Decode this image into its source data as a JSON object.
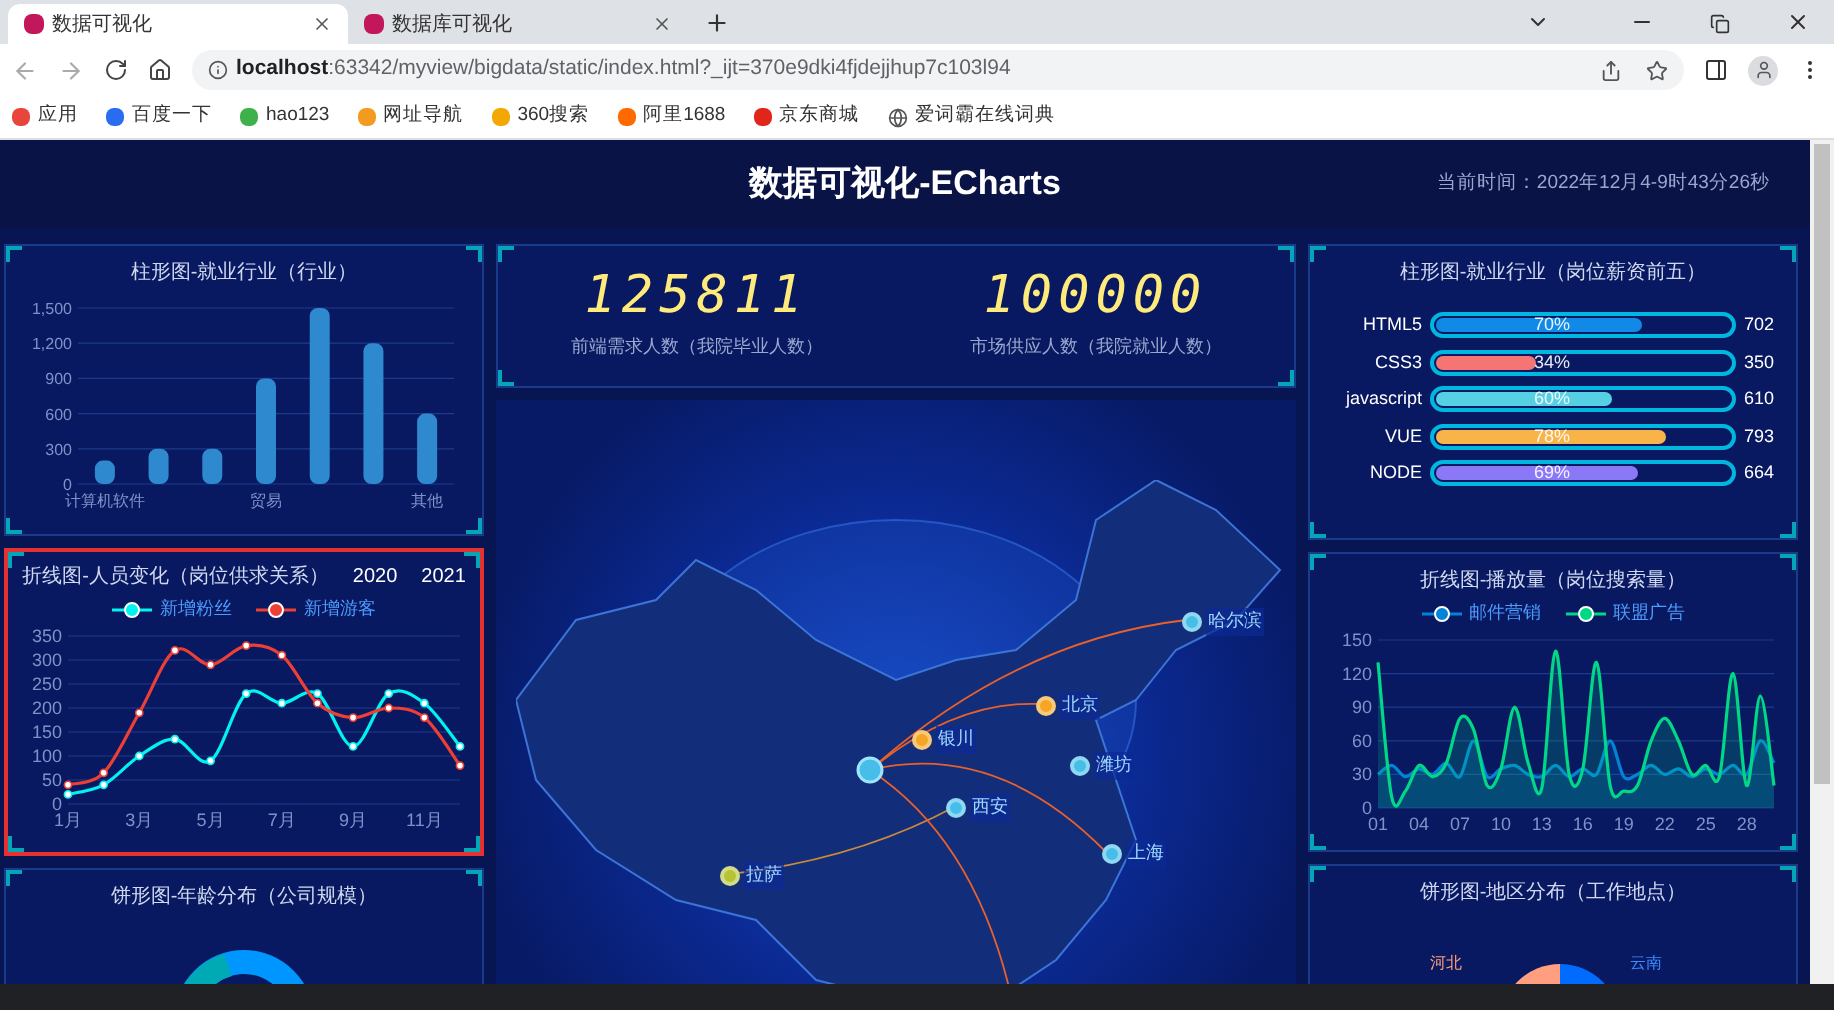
{
  "browser": {
    "tabs": [
      {
        "title": "数据可视化",
        "selected": true
      },
      {
        "title": "数据库可视化",
        "selected": false
      }
    ],
    "url_host": "localhost",
    "url_rest": ":63342/myview/bigdata/static/index.html?_ijt=370e9dki4fjdejjhup7c103l94",
    "bookmarks": [
      "应用",
      "百度一下",
      "hao123",
      "网址导航",
      "360搜索",
      "阿里1688",
      "京东商城",
      "爱词霸在线词典"
    ]
  },
  "header": {
    "title": "数据可视化-ECharts",
    "time": "当前时间：2022年12月4-9时43分26秒"
  },
  "industry_bar": {
    "title": "柱形图-就业行业（行业）",
    "chart_data": {
      "type": "bar",
      "grid": true,
      "categories": [
        "计算机软件",
        null,
        null,
        "贸易",
        null,
        null,
        "其他"
      ],
      "values": [
        200,
        300,
        300,
        900,
        1500,
        1200,
        600
      ],
      "ylim": [
        0,
        1500
      ],
      "yticks": [
        {
          "value": 0,
          "label": "0"
        },
        {
          "value": 300,
          "label": "300"
        },
        {
          "value": 600,
          "label": "600"
        },
        {
          "value": 900,
          "label": "900"
        },
        {
          "value": 1200,
          "label": "1,200"
        },
        {
          "value": 1500,
          "label": "1,500"
        }
      ],
      "color": "#2f89cf"
    }
  },
  "people_line": {
    "title": "折线图-人员变化（岗位供求关系）",
    "annotated": true,
    "years": [
      {
        "label": "2020",
        "selected": false
      },
      {
        "label": "2021",
        "selected": false
      }
    ],
    "chart_data": {
      "type": "line",
      "grid": true,
      "categories": [
        "1月",
        null,
        "3月",
        null,
        "5月",
        null,
        "7月",
        null,
        "9月",
        null,
        "11月",
        null
      ],
      "ylim": [
        0,
        350
      ],
      "yticks": [
        0,
        50,
        100,
        150,
        200,
        250,
        300,
        350
      ],
      "series": [
        {
          "name": "新增粉丝",
          "color": "#00f2f1",
          "marker": "circle",
          "values": [
            20,
            40,
            100,
            135,
            90,
            230,
            210,
            230,
            120,
            230,
            210,
            120
          ]
        },
        {
          "name": "新增游客",
          "color": "#ed3f35",
          "marker": "circle",
          "values": [
            40,
            65,
            190,
            320,
            290,
            330,
            310,
            210,
            180,
            200,
            180,
            80
          ]
        }
      ]
    }
  },
  "age_pie": {
    "title": "饼形图-年龄分布（公司规模）"
  },
  "counters": [
    {
      "value": "125811",
      "label": "前端需求人数（我院毕业人数）"
    },
    {
      "value": "100000",
      "label": "市场供应人数（我院就业人数）"
    }
  ],
  "map": {
    "cities": [
      {
        "name": "哈尔滨",
        "kind": "plain"
      },
      {
        "name": "北京",
        "kind": "hot"
      },
      {
        "name": "银川",
        "kind": "hot"
      },
      {
        "name": "西安",
        "kind": "plain"
      },
      {
        "name": "潍坊",
        "kind": "plain"
      },
      {
        "name": "上海",
        "kind": "plain"
      },
      {
        "name": "拉萨",
        "kind": "far"
      }
    ]
  },
  "skills": {
    "title": "柱形图-就业行业（岗位薪资前五）",
    "items": [
      {
        "name": "HTML5",
        "percent": "70%",
        "value": "702",
        "level": 0.7,
        "color": "#1089e7"
      },
      {
        "name": "CSS3",
        "percent": "34%",
        "value": "350",
        "level": 0.34,
        "color": "#f57474"
      },
      {
        "name": "javascript",
        "percent": "60%",
        "value": "610",
        "level": 0.6,
        "color": "#56d0e3"
      },
      {
        "name": "VUE",
        "percent": "78%",
        "value": "793",
        "level": 0.78,
        "color": "#f8b448"
      },
      {
        "name": "NODE",
        "percent": "69%",
        "value": "664",
        "level": 0.69,
        "color": "#8b78f6"
      }
    ]
  },
  "play_line": {
    "title": "折线图-播放量（岗位搜索量）",
    "chart_data": {
      "type": "area",
      "grid": true,
      "categories": [
        "01",
        null,
        null,
        "04",
        null,
        null,
        "07",
        null,
        null,
        "10",
        null,
        null,
        "13",
        null,
        null,
        "16",
        null,
        null,
        "19",
        null,
        null,
        "22",
        null,
        null,
        "25",
        null,
        null,
        "28",
        null,
        null
      ],
      "ylim": [
        0,
        150
      ],
      "yticks": [
        0,
        30,
        60,
        90,
        120,
        150
      ],
      "series": [
        {
          "name": "邮件营销",
          "color": "#0184d5",
          "values": [
            30,
            38,
            28,
            35,
            30,
            40,
            28,
            60,
            28,
            35,
            38,
            30,
            28,
            38,
            28,
            35,
            30,
            60,
            28,
            30,
            38,
            30,
            35,
            28,
            35,
            30,
            38,
            30,
            60,
            40
          ]
        },
        {
          "name": "联盟广告",
          "color": "#00d887",
          "values": [
            130,
            10,
            15,
            38,
            28,
            40,
            80,
            70,
            20,
            35,
            90,
            40,
            18,
            140,
            30,
            35,
            130,
            20,
            15,
            20,
            60,
            80,
            60,
            30,
            38,
            28,
            120,
            20,
            100,
            20
          ]
        }
      ]
    }
  },
  "region_pie": {
    "title": "饼形图-地区分布（工作地点）",
    "labels": [
      "河北",
      "云南"
    ]
  }
}
